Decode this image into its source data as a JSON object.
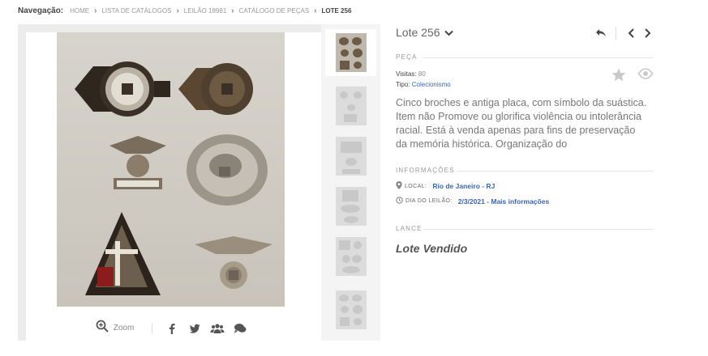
{
  "breadcrumb": {
    "label": "Navegação:",
    "items": [
      "HOME",
      "LISTA DE CATÁLOGOS",
      "LEILÃO 18981",
      "CATÁLOGO DE PEÇAS",
      "LOTE 256"
    ]
  },
  "gallery": {
    "zoom_label": "Zoom",
    "share_icons": [
      "facebook-icon",
      "twitter-icon",
      "group-icon",
      "comment-icon"
    ],
    "thumbnail_count": 6
  },
  "lot": {
    "title": "Lote 256",
    "section_piece": "PEÇA",
    "visits_label": "Visitas:",
    "visits_value": "80",
    "type_label": "Tipo:",
    "type_value": "Colecionismo",
    "description": "Cinco broches e antiga placa, com símbolo da suástica. Item não Promove ou glorifica violência ou intolerância racial. Está à venda apenas para fins de preservação da memória histórica. Organização do",
    "section_info": "INFORMAÇÕES",
    "local_label": "LOCAL:",
    "local_value": "Rio de Janeiro - RJ",
    "date_label": "DIA DO LEILÃO:",
    "date_value": "2/3/2021 - Mais informações",
    "section_bid": "LANCE",
    "status": "Lote Vendido"
  },
  "colors": {
    "link": "#3a64b5",
    "panel_bg": "#ececec",
    "muted_text": "#777777"
  }
}
